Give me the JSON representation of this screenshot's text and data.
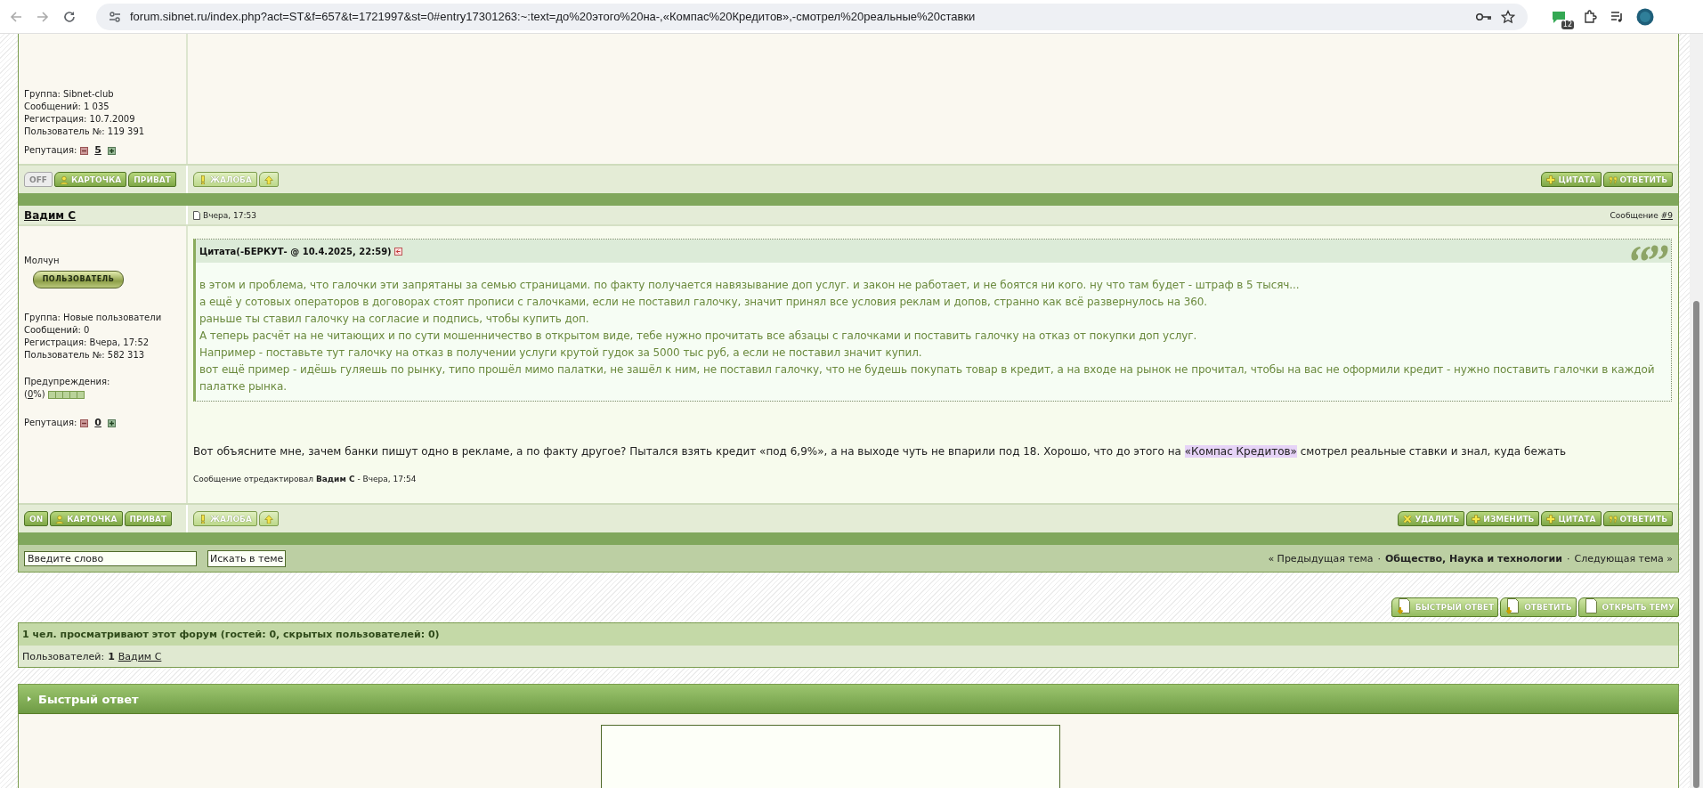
{
  "browser": {
    "url": "forum.sibnet.ru/index.php?act=ST&f=657&t=1721997&st=0#entry17301263:~:text=до%20этого%20на-,«Компас%20Кредитов»,-смотрел%20реальные%20ставки",
    "extension_badge": "12"
  },
  "posts": [
    {
      "profile_lines": [
        "Группа: Sibnet-club",
        "Сообщений: 1 035",
        "Регистрация: 10.7.2009",
        "Пользователь №: 119 391"
      ],
      "reputation_label": "Репутация:",
      "reputation": "5",
      "status": {
        "label": "OFF",
        "online": false
      },
      "user_buttons": [
        {
          "kind": "card",
          "label": "КАРТОЧКА"
        },
        {
          "kind": "plain",
          "label": "ПРИВАТ"
        }
      ],
      "mod_buttons": [
        {
          "kind": "complaint",
          "label": "ЖАЛОБА"
        },
        {
          "kind": "up"
        }
      ],
      "post_buttons": [
        {
          "kind": "quote",
          "label": "ЦИТАТА"
        },
        {
          "kind": "reply",
          "label": "ОТВЕТИТЬ"
        }
      ]
    },
    {
      "author": "Вадим С",
      "date": "Вчера, 17:53",
      "message_label": "Сообщение",
      "message_number": "#9",
      "rank": "Молчун",
      "badge": "ПОЛЬЗОВАТЕЛЬ",
      "profile_lines": [
        "Группа: Новые пользователи",
        "Сообщений: 0",
        "Регистрация: Вчера, 17:52",
        "Пользователь №: 582 313"
      ],
      "warnings": {
        "label": "Предупреждения:",
        "prefix": "(",
        "value": "0",
        "suffix": "%)",
        "level": 0
      },
      "reputation_label": "Репутация:",
      "reputation": "0",
      "quote": {
        "title": "Цитата(-БЕРКУТ- @ 10.4.2025, 22:59)",
        "lines": [
          "в этом и проблема, что галочки эти запрятаны за семью страницами. по факту получается навязывание доп услуг. и закон не работает, и не боятся ни кого. ну что там будет - штраф в 5 тысяч...",
          "а ещё у сотовых операторов в договорах стоят прописи с галочками, если не поставил галочку, значит принял все условия реклам и допов, странно как всё развернулось на 360.",
          "раньше ты ставил галочку на согласие и подпись, чтобы купить доп.",
          "А теперь расчёт на не читающих и по сути мошенничество в открытом виде, тебе нужно прочитать все абзацы с галочками и поставить галочку на отказ от покупки доп услуг.",
          "Например - поставьте тут галочку на отказ в получении услуги крутой гудок за 5000 тыс руб, а если не поставил значит купил.",
          "вот ещё пример - идёшь гуляешь по рынку, типо прошёл мимо палатки, не зашёл к ним, не поставил галочку, что не будешь покупать товар в кредит, а на входе на рынок не прочитал, чтобы на вас не оформили кредит - нужно поставить галочки в каждой палатке рынка."
        ]
      },
      "body": {
        "before": "Вот объясните мне, зачем банки пишут одно в рекламе, а по факту другое? Пытался взять кредит «под 6,9%», а на выходе чуть не впарили под 18. Хорошо, что до этого на ",
        "highlight": "«Компас Кредитов»",
        "after": " смотрел реальные ставки и знал, куда бежать"
      },
      "edited": "Сообщение отредактировал **Вадим С** - Вчера, 17:54",
      "status": {
        "label": "ON",
        "online": true
      },
      "user_buttons": [
        {
          "kind": "card",
          "label": "КАРТОЧКА"
        },
        {
          "kind": "plain",
          "label": "ПРИВАТ"
        }
      ],
      "mod_buttons": [
        {
          "kind": "complaint",
          "label": "ЖАЛОБА"
        },
        {
          "kind": "up"
        }
      ],
      "post_buttons": [
        {
          "kind": "delete",
          "label": "УДАЛИТЬ"
        },
        {
          "kind": "edit",
          "label": "ИЗМЕНИТЬ"
        },
        {
          "kind": "quote",
          "label": "ЦИТАТА"
        },
        {
          "kind": "reply",
          "label": "ОТВЕТИТЬ"
        }
      ]
    }
  ],
  "topic_search": {
    "value": "Введите слово",
    "button": "Искать в теме"
  },
  "topic_nav": {
    "previous": "« Предыдущая тема",
    "separator_1": "·",
    "forum": "Общество, Наука и технологии",
    "separator_2": "·",
    "next": "Следующая тема »"
  },
  "topic_buttons": [
    {
      "kind": "fast_reply",
      "label": "БЫСТРЫЙ ОТВЕТ"
    },
    {
      "kind": "reply",
      "label": "ОТВЕТИТЬ"
    },
    {
      "kind": "new_topic",
      "label": "ОТКРЫТЬ ТЕМУ"
    }
  ],
  "online": {
    "title": "1 чел. просматривают этот форум (гостей: 0, скрытых пользователей: 0)",
    "users_label": "Пользователей:",
    "users_count": "1",
    "users": [
      "Вадим С"
    ]
  },
  "quick_reply": {
    "title": "Быстрый ответ"
  }
}
